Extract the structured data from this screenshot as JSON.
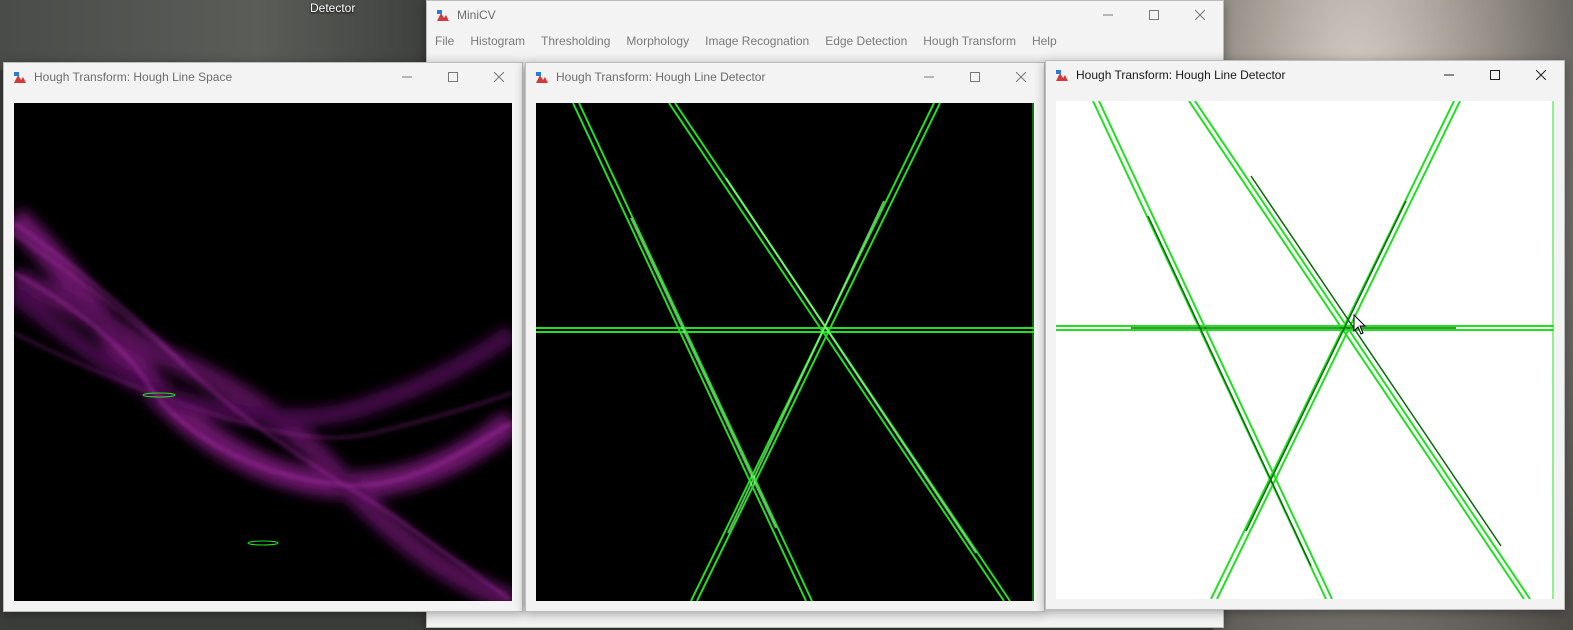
{
  "desktop": {
    "icon_label": "Detector"
  },
  "main_window": {
    "title": "MiniCV",
    "menu": [
      "File",
      "Histogram",
      "Thresholding",
      "Morphology",
      "Image Recognation",
      "Edge Detection",
      "Hough Transform",
      "Help"
    ]
  },
  "space_window": {
    "title": "Hough Transform: Hough Line Space"
  },
  "detector_window_1": {
    "title": "Hough Transform: Hough Line Detector"
  },
  "detector_window_2": {
    "title": "Hough Transform: Hough Line Detector"
  },
  "colors": {
    "line_green": "#20e020",
    "accumulator_magenta": "#b030b0",
    "background_dark": "#000000",
    "background_light": "#ffffff"
  }
}
